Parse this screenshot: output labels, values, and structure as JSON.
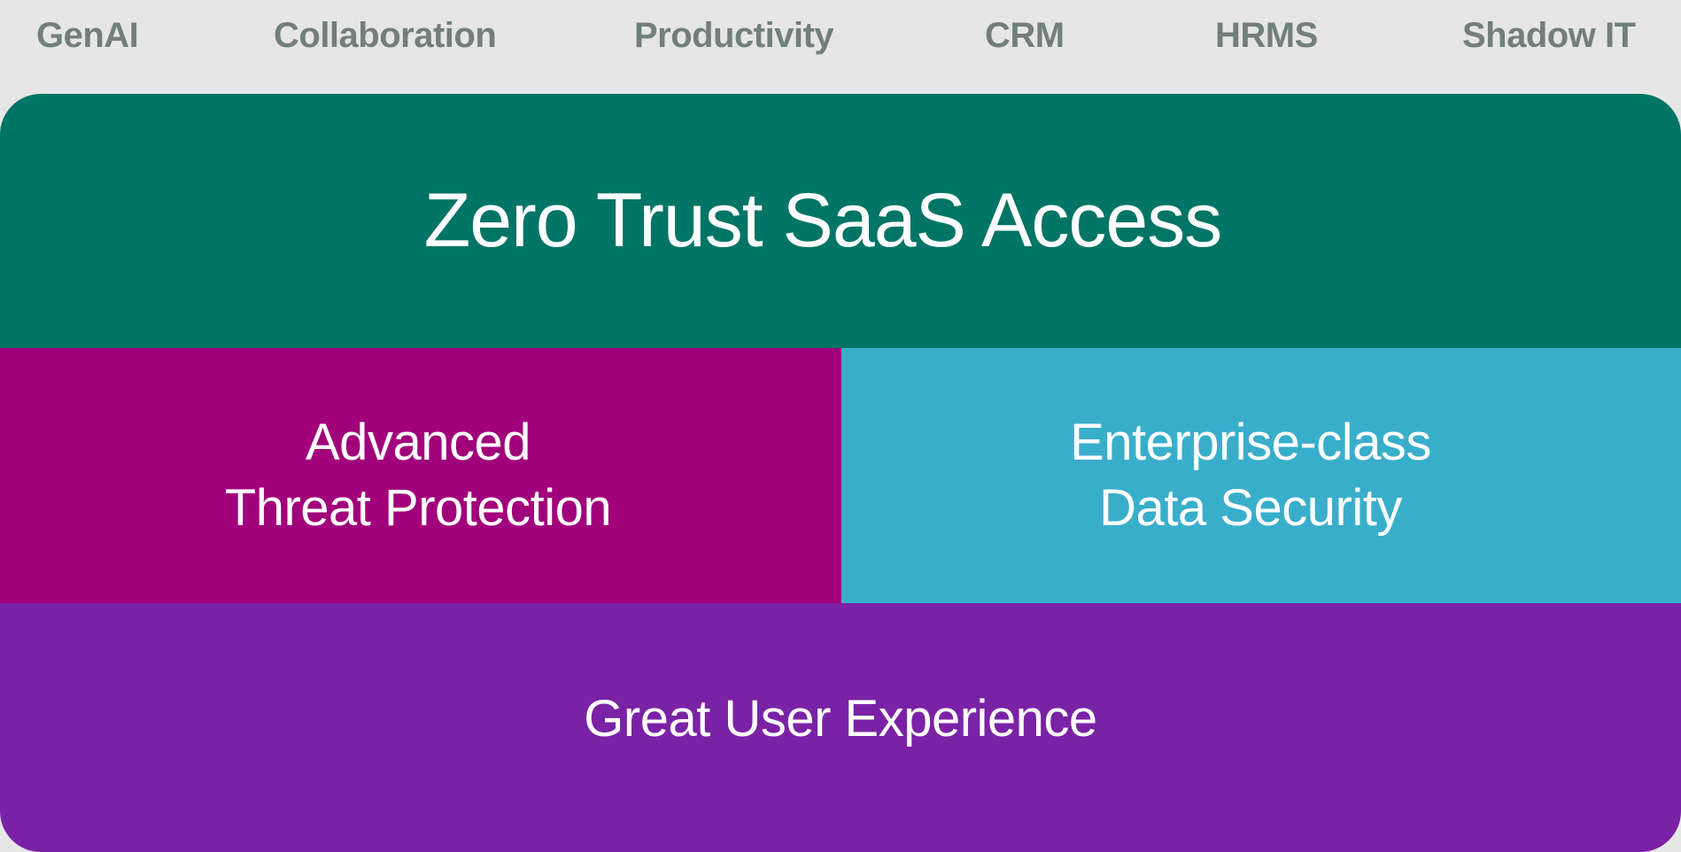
{
  "categories": [
    {
      "label": "GenAI"
    },
    {
      "label": "Collaboration"
    },
    {
      "label": "Productivity"
    },
    {
      "label": "CRM"
    },
    {
      "label": "HRMS"
    },
    {
      "label": "Shadow IT"
    }
  ],
  "layers": {
    "top": {
      "label": "Zero Trust SaaS Access",
      "color": "#017565"
    },
    "middle_left": {
      "line1": "Advanced",
      "line2": "Threat Protection",
      "color": "#a1017a"
    },
    "middle_right": {
      "line1": "Enterprise-class",
      "line2": "Data Security",
      "color": "#39aecb"
    },
    "bottom": {
      "label": "Great User Experience",
      "color": "#7a22a5"
    }
  }
}
